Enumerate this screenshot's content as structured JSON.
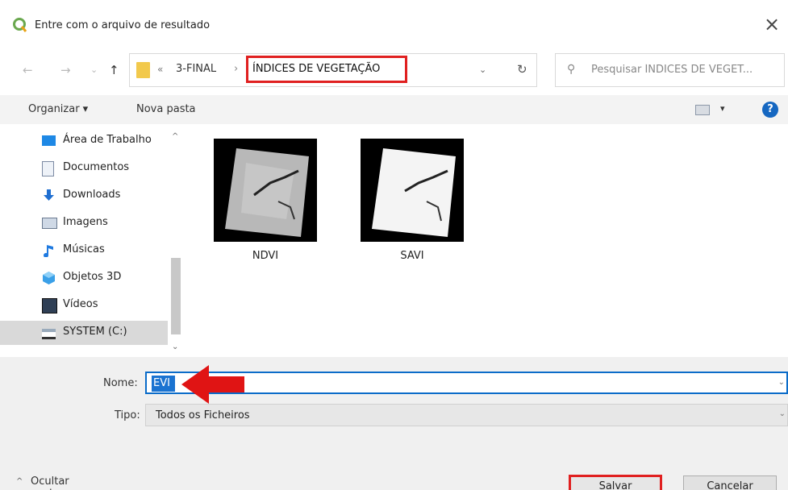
{
  "window": {
    "title": "Entre com o arquivo de resultado",
    "close_glyph": "×"
  },
  "nav": {
    "back_glyph": "←",
    "forward_glyph": "→",
    "recent_glyph": "⌄",
    "up_glyph": "↑",
    "crumb_chevron": "«",
    "breadcrumb": [
      "3-FINAL",
      "ÍNDICES DE VEGETAÇÃO"
    ],
    "crumb_separator": "›",
    "dropdown_glyph": "⌄",
    "refresh_glyph": "↻",
    "search_icon": "⚲",
    "search_placeholder": "Pesquisar ÍNDICES DE VEGET..."
  },
  "toolbar": {
    "organize_label": "Organizar ▾",
    "new_folder_label": "Nova pasta",
    "view_caret": "▾",
    "help_glyph": "?"
  },
  "sidebar": {
    "items": [
      {
        "label": "Área de Trabalho",
        "icon": "desktop-icon"
      },
      {
        "label": "Documentos",
        "icon": "documents-icon"
      },
      {
        "label": "Downloads",
        "icon": "downloads-icon"
      },
      {
        "label": "Imagens",
        "icon": "pictures-icon"
      },
      {
        "label": "Músicas",
        "icon": "music-icon"
      },
      {
        "label": "Objetos 3D",
        "icon": "objects3d-icon"
      },
      {
        "label": "Vídeos",
        "icon": "videos-icon"
      },
      {
        "label": "SYSTEM (C:)",
        "icon": "drive-icon",
        "selected": true
      }
    ],
    "scroll_up_glyph": "^",
    "scroll_down_glyph": "⌄"
  },
  "files": [
    {
      "name": "NDVI"
    },
    {
      "name": "SAVI"
    }
  ],
  "form": {
    "name_label": "Nome:",
    "name_value": "EVI",
    "type_label": "Tipo:",
    "type_value": "Todos os Ficheiros",
    "dropdown_glyph": "⌄"
  },
  "footer": {
    "hide_folders_caret": "^",
    "hide_folders_label": "Ocultar pastas",
    "save_label": "Salvar",
    "cancel_label": "Cancelar"
  },
  "colors": {
    "highlight": "#e02020",
    "accent": "#1a73d1",
    "qgis_logo": "#6aa84f"
  }
}
